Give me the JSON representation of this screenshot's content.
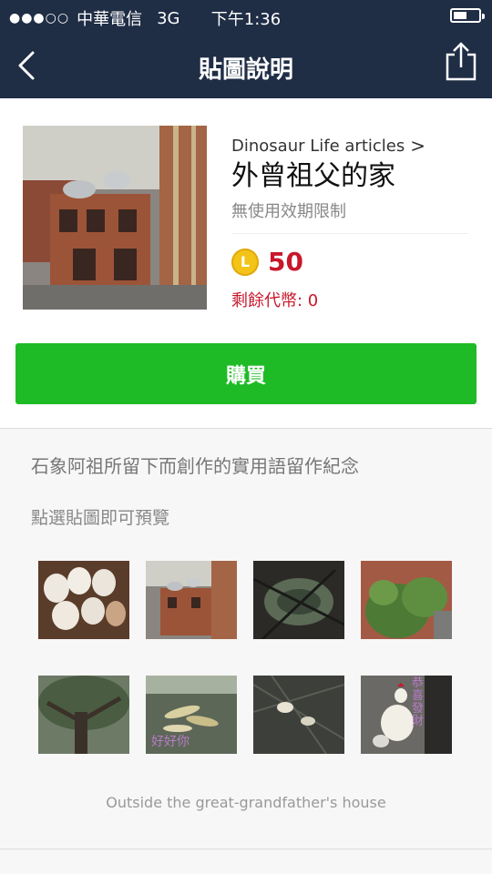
{
  "status_bar": {
    "signal": "●●●○○",
    "carrier": "中華電信",
    "network": "3G",
    "time": "下午1:36",
    "battery_level": 0.55
  },
  "nav": {
    "title": "貼圖說明",
    "back_icon": "chevron-left-icon",
    "share_icon": "share-icon"
  },
  "product": {
    "author": "Dinosaur Life articles",
    "author_chevron": ">",
    "title": "外曾祖父的家",
    "validity": "無使用效期限制",
    "coin_letter": "L",
    "price": "50",
    "remaining_coins": "剩餘代幣: 0",
    "buy_label": "購買"
  },
  "details": {
    "description": "石象阿祖所留下而創作的實用語留作紀念",
    "preview_hint": "點選貼圖即可預覽",
    "footer_note": "Outside the great-grandfather's house"
  },
  "stickers": [
    {
      "label": ""
    },
    {
      "label": ""
    },
    {
      "label": ""
    },
    {
      "label": ""
    },
    {
      "label": ""
    },
    {
      "label": "好好你"
    },
    {
      "label": ""
    },
    {
      "label": "恭喜發財"
    }
  ],
  "colors": {
    "header_bg": "#1f2d45",
    "buy_green": "#1fbb26",
    "price_red": "#c8172b",
    "coin_gold": "#f3c417"
  }
}
